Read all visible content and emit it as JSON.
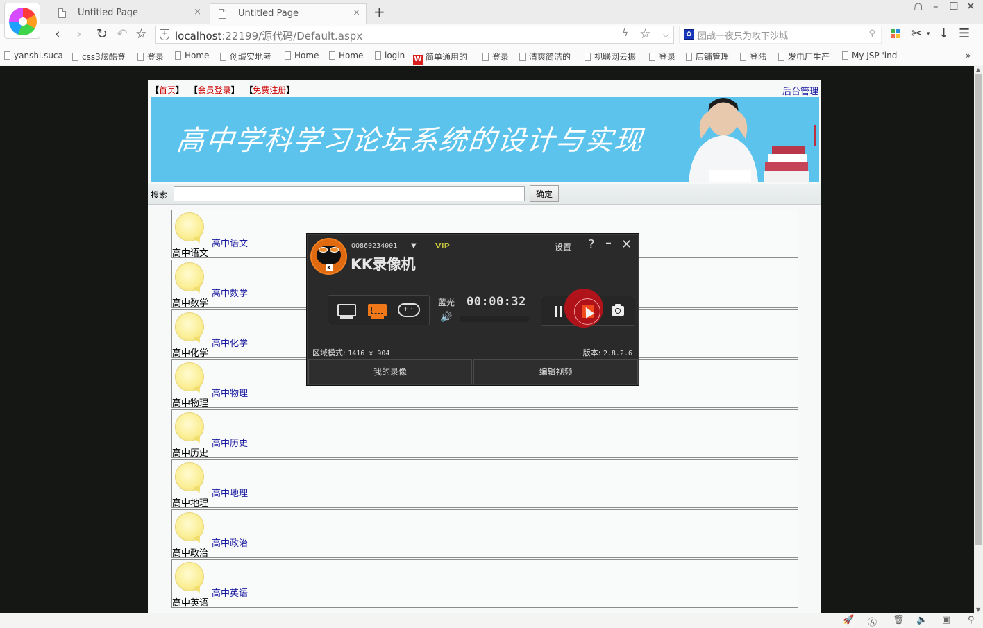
{
  "browser": {
    "tabs": [
      {
        "title": "Untitled Page",
        "active": false
      },
      {
        "title": "Untitled Page",
        "active": true
      }
    ],
    "new_tab_label": "+",
    "window_controls": [
      "skin",
      "minimize",
      "maximize",
      "close"
    ],
    "address": {
      "host": "localhost",
      "rest": ":22199/源代码/Default.aspx"
    },
    "search": {
      "placeholder": "团战一夜只为攻下沙城",
      "engine_icon": "baidu-paw-icon"
    },
    "bookmarks": [
      {
        "label": "yanshi.suca"
      },
      {
        "label": "css3炫酷登"
      },
      {
        "label": "登录"
      },
      {
        "label": "Home"
      },
      {
        "label": "创城实地考"
      },
      {
        "label": "Home"
      },
      {
        "label": "Home"
      },
      {
        "label": "login"
      },
      {
        "label": "简单通用的",
        "icon": "red"
      },
      {
        "label": "登录"
      },
      {
        "label": "清爽简洁的"
      },
      {
        "label": "视联网云振"
      },
      {
        "label": "登录"
      },
      {
        "label": "店铺管理"
      },
      {
        "label": "登陆"
      },
      {
        "label": "发电厂生产"
      },
      {
        "label": "My JSP 'ind"
      }
    ],
    "bookmarks_more": "»"
  },
  "site": {
    "top_links": [
      {
        "label": "首页"
      },
      {
        "label": "会员登录"
      },
      {
        "label": "免费注册"
      }
    ],
    "admin_link": "后台管理",
    "banner_title": "高中学科学习论坛系统的设计与实现",
    "search_label": "搜索",
    "search_value": "",
    "search_button": "确定",
    "forums": [
      {
        "link": "高中语文",
        "name": "高中语文"
      },
      {
        "link": "高中数学",
        "name": "高中数学"
      },
      {
        "link": "高中化学",
        "name": "高中化学"
      },
      {
        "link": "高中物理",
        "name": "高中物理"
      },
      {
        "link": "高中历史",
        "name": "高中历史"
      },
      {
        "link": "高中地理",
        "name": "高中地理"
      },
      {
        "link": "高中政治",
        "name": "高中政治"
      },
      {
        "link": "高中英语",
        "name": "高中英语"
      }
    ]
  },
  "recorder": {
    "user": "QQ860234001",
    "vip": "VIP",
    "title": "KK录像机",
    "settings": "设置",
    "help": "?",
    "quality": "蓝光",
    "timer": "00:00:32",
    "mode_label": "区域模式:",
    "mode_value": "1416 x 904",
    "version_label": "版本:",
    "version_value": "2.8.2.6",
    "my_videos": "我的录像",
    "edit_video": "编辑视频",
    "active_mode": "region",
    "accent": "#f07818"
  }
}
